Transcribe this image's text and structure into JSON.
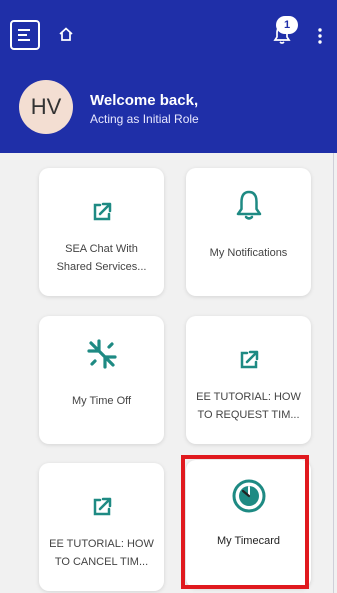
{
  "header": {
    "notification_count": "1",
    "avatar_initials": "HV",
    "welcome_text": "Welcome back,",
    "role_text": "Acting as Initial Role"
  },
  "tiles": [
    {
      "label_line1": "SEA Chat With",
      "label_line2": "Shared Services...",
      "icon": "external-link-icon"
    },
    {
      "label_line1": "My Notifications",
      "label_line2": "",
      "icon": "bell-icon"
    },
    {
      "label_line1": "My Time Off",
      "label_line2": "",
      "icon": "airplane-icon"
    },
    {
      "label_line1": "EE TUTORIAL: HOW",
      "label_line2": "TO REQUEST TIM...",
      "icon": "external-link-icon"
    },
    {
      "label_line1": "EE TUTORIAL: HOW",
      "label_line2": "TO CANCEL TIM...",
      "icon": "external-link-icon"
    },
    {
      "label_line1": "My Timecard",
      "label_line2": "",
      "icon": "timecard-icon"
    }
  ],
  "colors": {
    "header_bg": "#1f2fa8",
    "accent_teal": "#1e8a83",
    "highlight_red": "#e0191e"
  }
}
